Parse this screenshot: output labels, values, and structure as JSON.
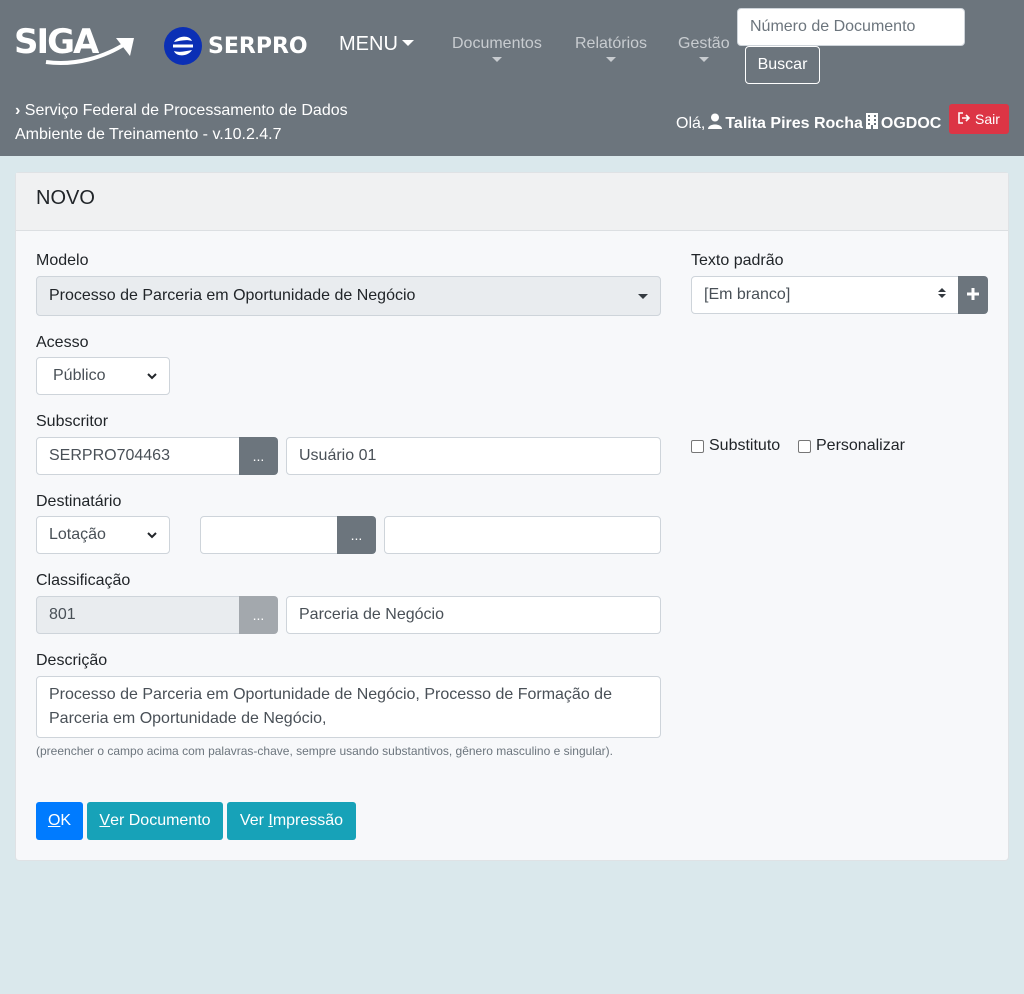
{
  "header": {
    "logo_siga": "SIGA",
    "logo_serpro": "SERPRO",
    "menu_label": "MENU",
    "nav": [
      {
        "label": "Documentos"
      },
      {
        "label": "Relatórios"
      },
      {
        "label": "Gestão"
      }
    ],
    "search_placeholder": "Número de Documento",
    "search_button": "Buscar",
    "org_name": "Serviço Federal de Processamento de Dados",
    "environment": "Ambiente de Treinamento - v.10.2.4.7",
    "greeting": "Olá,",
    "user_name": "Talita Pires Rocha",
    "unit": "OGDOC",
    "logout": "Sair",
    "colors": {
      "bar": "#6c757d",
      "logout": "#dc3545"
    }
  },
  "card": {
    "title": "NOVO"
  },
  "form": {
    "modelo_label": "Modelo",
    "modelo_value": "Processo de Parceria em Oportunidade de Negócio",
    "texto_padrao_label": "Texto padrão",
    "texto_padrao_value": "[Em branco]",
    "acesso_label": "Acesso",
    "acesso_value": "Público",
    "subscritor_label": "Subscritor",
    "subscritor_code": "SERPRO704463",
    "subscritor_name": "Usuário 01",
    "dots": "...",
    "substituto_label": "Substituto",
    "personalizar_label": "Personalizar",
    "destinatario_label": "Destinatário",
    "destinatario_type": "Lotação",
    "destinatario_code": "",
    "destinatario_name": "",
    "classificacao_label": "Classificação",
    "classificacao_code": "801",
    "classificacao_name": "Parceria de Negócio",
    "descricao_label": "Descrição",
    "descricao_value": "Processo de Parceria em Oportunidade de Negócio, Processo de Formação de Parceria em Oportunidade de Negócio,",
    "descricao_hint": "(preencher o campo acima com palavras-chave, sempre usando substantivos, gênero masculino e singular).",
    "btn_ok_u": "O",
    "btn_ok_rest": "K",
    "btn_ver_doc_u": "V",
    "btn_ver_doc_rest": "er Documento",
    "btn_ver_imp_pre": "Ver ",
    "btn_ver_imp_u": "I",
    "btn_ver_imp_rest": "mpressão"
  },
  "colors": {
    "background": "#dae8ec",
    "primary": "#007bff",
    "info": "#17a2b8",
    "secondary": "#6c757d"
  }
}
